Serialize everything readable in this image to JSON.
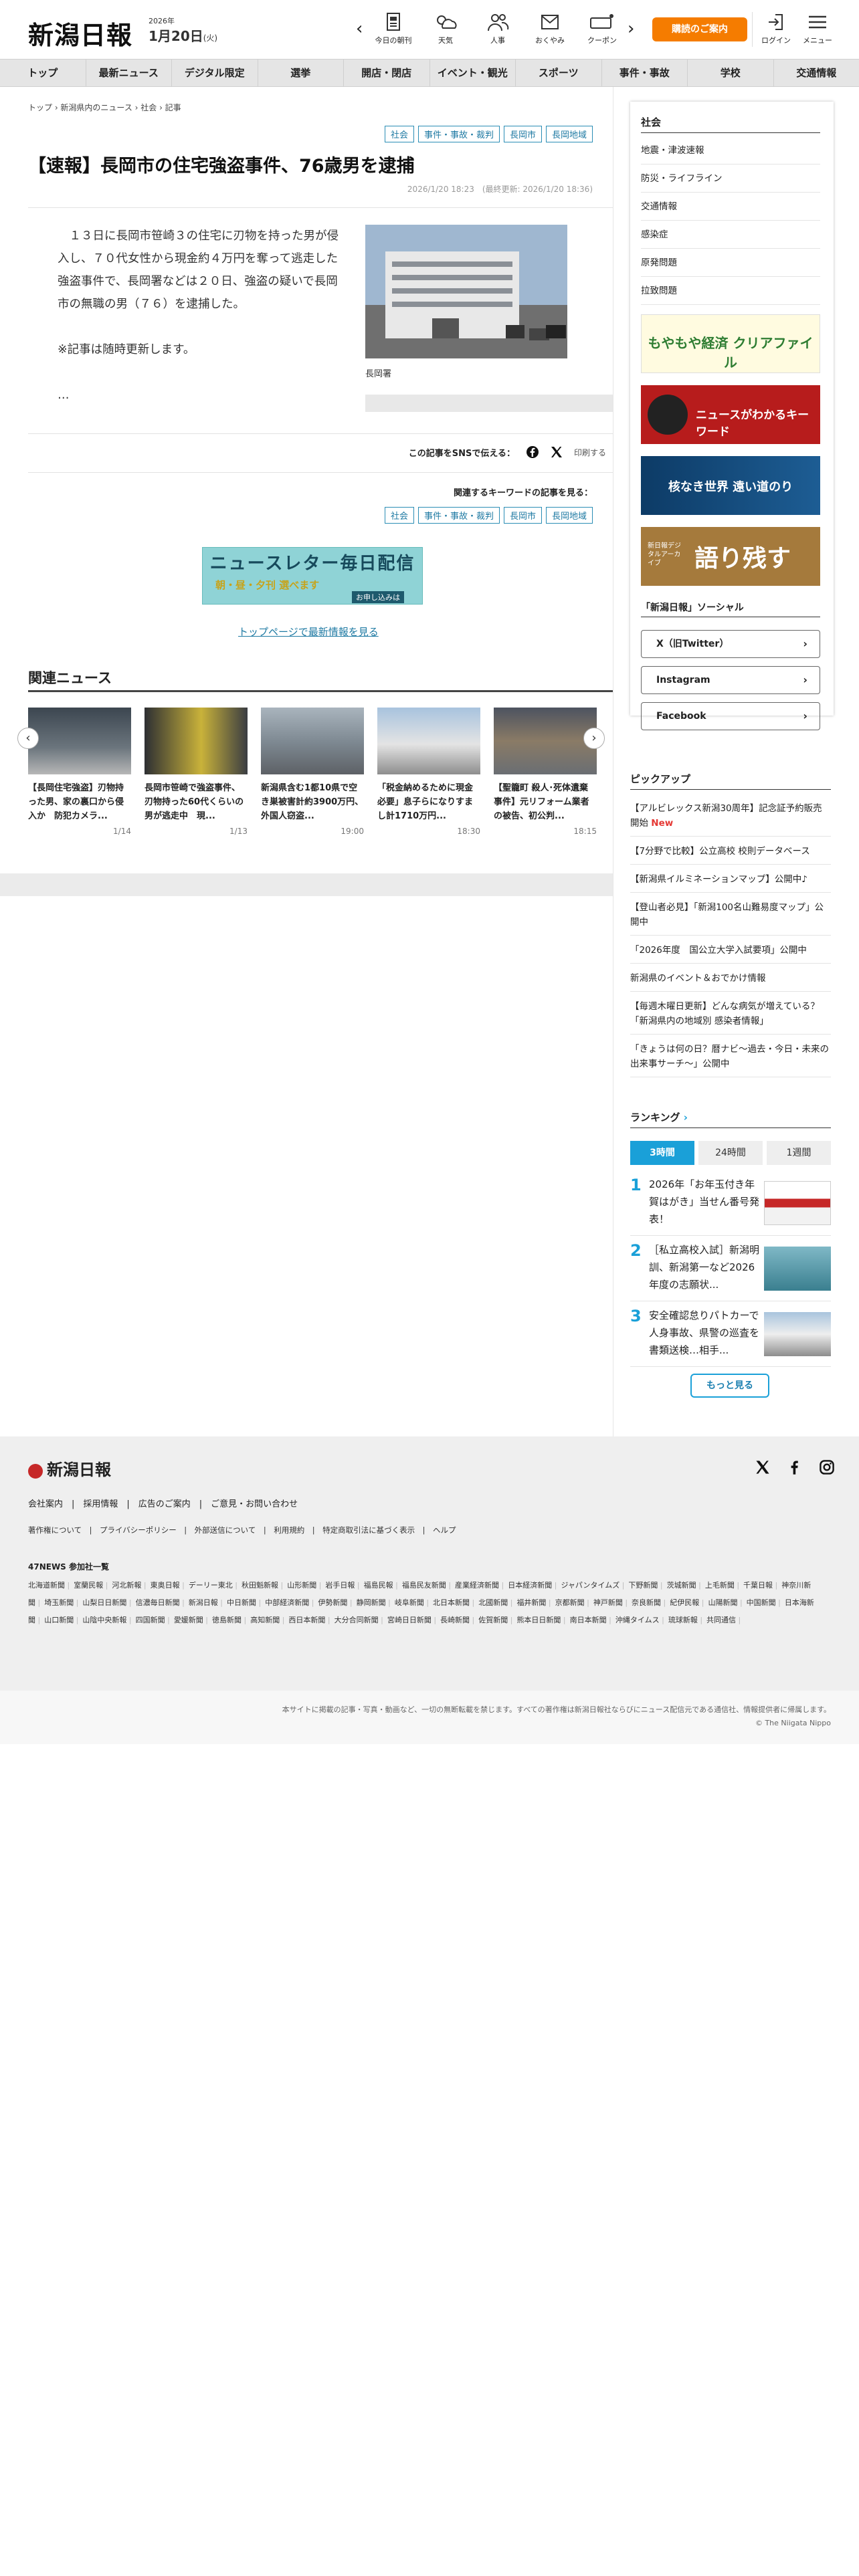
{
  "header": {
    "logo": "新潟日報",
    "date_year": "2026年",
    "date_md": "1月20日",
    "date_weekday": "(火)",
    "icons": [
      {
        "label": "今日の朝刊",
        "icon": "newspaper-icon"
      },
      {
        "label": "天気",
        "icon": "weather-icon"
      },
      {
        "label": "人事",
        "icon": "people-icon"
      },
      {
        "label": "おくやみ",
        "icon": "condolence-icon"
      },
      {
        "label": "クーポン",
        "icon": "coupon-icon"
      }
    ],
    "subscribe_label": "購読のご案内",
    "login_label": "ログイン",
    "menu_label": "メニュー"
  },
  "nav": [
    "トップ",
    "最新ニュース",
    "デジタル限定",
    "選挙",
    "開店・閉店",
    "イベント・観光",
    "スポーツ",
    "事件・事故",
    "学校",
    "交通情報"
  ],
  "breadcrumb": "トップ › 新潟県内のニュース › 社会 › 記事",
  "article": {
    "tags": [
      "社会",
      "事件・事故・裁判",
      "長岡市",
      "長岡地域"
    ],
    "title": "【速報】長岡市の住宅強盗事件、76歳男を逮捕",
    "published": "2026/1/20 18:23　(最終更新: 2026/1/20 18:36)",
    "paragraphs": [
      "　１３日に長岡市笹崎３の住宅に刃物を持った男が侵入し、７０代女性から現金約４万円を奪って逃走した強盗事件で、長岡署などは２０日、強盗の疑いで長岡市の無職の男（７６）を逮捕した。",
      "※記事は随時更新します。",
      "…"
    ],
    "photo_caption": "長岡署",
    "share_label": "この記事をSNSで伝える：",
    "print_label": "印刷する",
    "keyword_label": "関連するキーワードの記事を見る：",
    "keyword_tags": [
      "社会",
      "事件・事故・裁判",
      "長岡市",
      "長岡地域"
    ],
    "newsletter_title": "ニュースレター毎日配信",
    "newsletter_sub": "朝・昼・夕刊 選べます",
    "newsletter_btn": "お申し込みは",
    "top_link": "トップページで最新情報を見る"
  },
  "related": {
    "title": "関連ニュース",
    "items": [
      {
        "title": "【長岡住宅強盗】刃物持った男、家の裏口から侵入か　防犯カメラ...",
        "date": "1/14"
      },
      {
        "title": "長岡市笹崎で強盗事件、刃物持った60代くらいの男が逃走中　現...",
        "date": "1/13"
      },
      {
        "title": "新潟県含む1都10県で空き巣被害計約3900万円、外国人窃盗...",
        "date": "19:00"
      },
      {
        "title": "「税金納めるために現金必要」息子らになりすまし計1710万円...",
        "date": "18:30"
      },
      {
        "title": "【聖籠町 殺人･死体遺棄事件】元リフォーム業者の被告、初公判...",
        "date": "18:15"
      }
    ]
  },
  "sidebar": {
    "title": "社会",
    "items": [
      "地震・津波速報",
      "防災・ライフライン",
      "交通情報",
      "感染症",
      "原発問題",
      "拉致問題"
    ],
    "banners": [
      {
        "text": "もやもや経済 クリアファイル"
      },
      {
        "text": "ニュースがわかるキーワード"
      },
      {
        "text": "核なき世界 遠い道のり"
      },
      {
        "text": "語り残す",
        "sub": "新日報デジタルアーカイブ"
      }
    ],
    "social_title": "「新潟日報」ソーシャル",
    "social": [
      "X（旧Twitter）",
      "Instagram",
      "Facebook"
    ]
  },
  "pickup": {
    "title": "ピックアップ",
    "items": [
      {
        "text": "【アルビレックス新潟30周年】記念証予約販売開始",
        "badge": "New"
      },
      {
        "text": "【7分野で比較】公立高校 校則データベース"
      },
      {
        "text": "【新潟県イルミネーションマップ】公開中♪"
      },
      {
        "text": "【登山者必見】「新潟100名山難易度マップ」公開中"
      },
      {
        "text": "「2026年度　国公立大学入試要項」公開中"
      },
      {
        "text": "新潟県のイベント＆おでかけ情報"
      },
      {
        "text": "【毎週木曜日更新】どんな病気が増えている？「新潟県内の地域別 感染者情報」"
      },
      {
        "text": "「きょうは何の日？暦ナビ～過去・今日・未来の出来事サーチ～」公開中"
      }
    ]
  },
  "ranking": {
    "title": "ランキング",
    "tabs": [
      "3時間",
      "24時間",
      "1週間"
    ],
    "items": [
      {
        "rank": "1",
        "title": "2026年「お年玉付き年賀はがき」当せん番号発表！"
      },
      {
        "rank": "2",
        "title": "［私立高校入試］新潟明訓、新潟第一など2026年度の志願状..."
      },
      {
        "rank": "3",
        "title": "安全確認怠りパトカーで人身事故、県警の巡査を書類送検…相手..."
      }
    ],
    "more_label": "もっと見る"
  },
  "footer": {
    "logo": "新潟日報",
    "links1": "会社案内　|　採用情報　|　広告のご案内　|　ご意見・お問い合わせ",
    "links2": "著作権について　|　プライバシーポリシー　|　外部送信について　|　利用規約　|　特定商取引法に基づく表示　|　ヘルプ",
    "news47": "47NEWS 参加社一覧",
    "papers": [
      "北海道新聞",
      "室蘭民報",
      "河北新報",
      "東奥日報",
      "デーリー東北",
      "秋田魁新報",
      "山形新聞",
      "岩手日報",
      "福島民報",
      "福島民友新聞",
      "産業経済新聞",
      "日本経済新聞",
      "ジャパンタイムズ",
      "下野新聞",
      "茨城新聞",
      "上毛新聞",
      "千葉日報",
      "神奈川新聞",
      "埼玉新聞",
      "山梨日日新聞",
      "信濃毎日新聞",
      "新潟日報",
      "中日新聞",
      "中部経済新聞",
      "伊勢新聞",
      "静岡新聞",
      "岐阜新聞",
      "北日本新聞",
      "北國新聞",
      "福井新聞",
      "京都新聞",
      "神戸新聞",
      "奈良新聞",
      "紀伊民報",
      "山陽新聞",
      "中国新聞",
      "日本海新聞",
      "山口新聞",
      "山陰中央新報",
      "四国新聞",
      "愛媛新聞",
      "徳島新聞",
      "高知新聞",
      "西日本新聞",
      "大分合同新聞",
      "宮崎日日新聞",
      "長崎新聞",
      "佐賀新聞",
      "熊本日日新聞",
      "南日本新聞",
      "沖縄タイムス",
      "琉球新報",
      "共同通信"
    ],
    "copy_notice": "本サイトに掲載の記事・写真・動画など、一切の無断転載を禁じます。すべての著作権は新潟日報社ならびにニュース配信元である通信社、情報提供者に帰属します。",
    "copyright": "© The Niigata Nippo"
  },
  "colors": {
    "accent": "#1aa0d8",
    "orange": "#f57c00",
    "tag": "#1f7aa3"
  }
}
